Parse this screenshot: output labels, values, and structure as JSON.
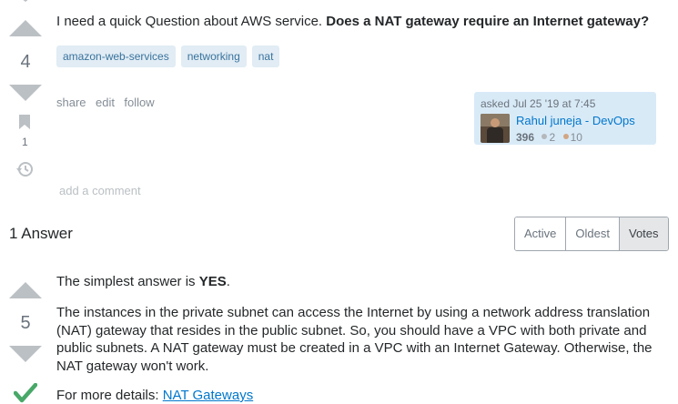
{
  "question": {
    "text_plain": "I need a quick Question about AWS service.",
    "text_bold": "Does a NAT gateway require an Internet gateway?",
    "vote_count": "4",
    "bookmark_count": "1",
    "tags": [
      "amazon-web-services",
      "networking",
      "nat"
    ],
    "menu": [
      "share",
      "edit",
      "follow"
    ],
    "asked": "asked Jul 25 '19 at 7:45",
    "user": {
      "name": "Rahul juneja - DevOps",
      "reputation": "396",
      "silver_badges": "2",
      "bronze_badges": "10"
    },
    "add_comment": "add a comment"
  },
  "answers": {
    "header": "1 Answer",
    "sort_tabs": [
      "Active",
      "Oldest",
      "Votes"
    ],
    "selected_tab": "Votes"
  },
  "answer": {
    "vote_count": "5",
    "p1_plain": "The simplest answer is ",
    "p1_bold": "YES",
    "p1_end": ".",
    "p2": "The instances in the private subnet can access the Internet by using a network address translation (NAT) gateway that resides in the public subnet. So, you should have a VPC with both private and public subnets. A NAT gateway must be created in a VPC with an Internet Gateway. Otherwise, the NAT gateway won't work.",
    "p3_plain": "For more details: ",
    "p3_link": "NAT Gateways"
  },
  "colors": {
    "accepted": "#48a868",
    "silver": "#b4b8bc",
    "bronze": "#d1a684",
    "link": "#0077cc"
  }
}
